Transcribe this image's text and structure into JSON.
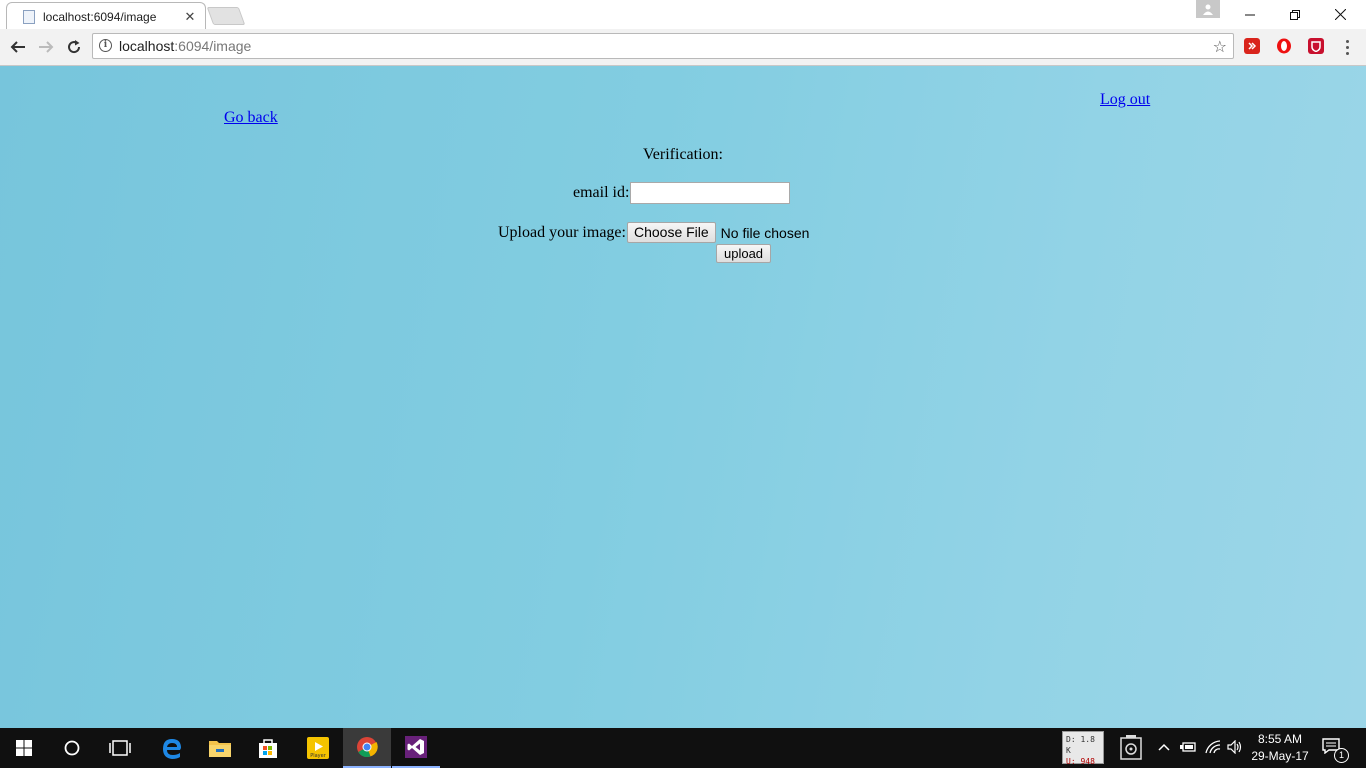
{
  "browser": {
    "tab_title": "localhost:6094/image",
    "url_host": "localhost",
    "url_path": ":6094/image",
    "window_controls": {
      "minimize": "—",
      "restore": "❐",
      "close": "✕"
    }
  },
  "page": {
    "go_back_label": "Go back",
    "log_out_label": "Log out",
    "verification_heading": "Verification:",
    "email_label": "email id:",
    "email_value": "",
    "upload_label": "Upload your image:",
    "choose_file_label": "Choose File",
    "file_status": "No file chosen",
    "upload_button_label": "upload",
    "background_color": "#82cde1",
    "link_color": "#0000ee"
  },
  "taskbar": {
    "net_meter_down": "D: 1.8 K",
    "net_meter_up": "U: 948",
    "time": "8:55 AM",
    "date": "29-May-17",
    "notification_count": "1"
  }
}
